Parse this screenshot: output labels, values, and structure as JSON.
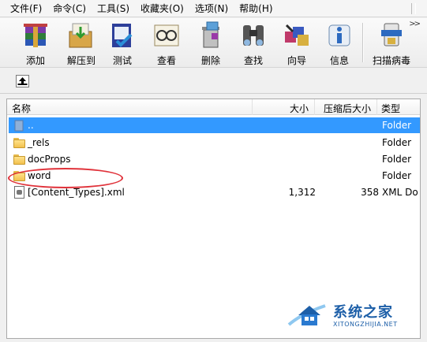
{
  "menu": [
    "文件(F)",
    "命令(C)",
    "工具(S)",
    "收藏夹(O)",
    "选项(N)",
    "帮助(H)"
  ],
  "toolbar": {
    "buttons": [
      {
        "label": "添加",
        "icon": "add-archive-icon"
      },
      {
        "label": "解压到",
        "icon": "extract-to-icon"
      },
      {
        "label": "测试",
        "icon": "test-icon"
      },
      {
        "label": "查看",
        "icon": "view-icon"
      },
      {
        "label": "删除",
        "icon": "delete-icon"
      },
      {
        "label": "查找",
        "icon": "find-icon"
      },
      {
        "label": "向导",
        "icon": "wizard-icon"
      },
      {
        "label": "信息",
        "icon": "info-icon"
      },
      {
        "label": "扫描病毒",
        "icon": "virus-scan-icon"
      }
    ]
  },
  "list": {
    "columns": {
      "name": "名称",
      "size": "大小",
      "packed": "压缩后大小",
      "type": "类型"
    },
    "rows": [
      {
        "name": "..",
        "size": "",
        "packed": "",
        "type": "Folder",
        "selected": true
      },
      {
        "name": "_rels",
        "size": "",
        "packed": "",
        "type": "Folder"
      },
      {
        "name": "docProps",
        "size": "",
        "packed": "",
        "type": "Folder"
      },
      {
        "name": "word",
        "size": "",
        "packed": "",
        "type": "Folder",
        "highlighted": true
      },
      {
        "name": "[Content_Types].xml",
        "size": "1,312",
        "packed": "358",
        "type": "XML Do"
      }
    ]
  },
  "watermark": {
    "title": "系统之家",
    "subtitle": "XITONGZHIJIA.NET"
  },
  "colors": {
    "selection": "#3399ff",
    "highlight_circle": "#e0323a",
    "watermark": "#1d5fa8"
  }
}
